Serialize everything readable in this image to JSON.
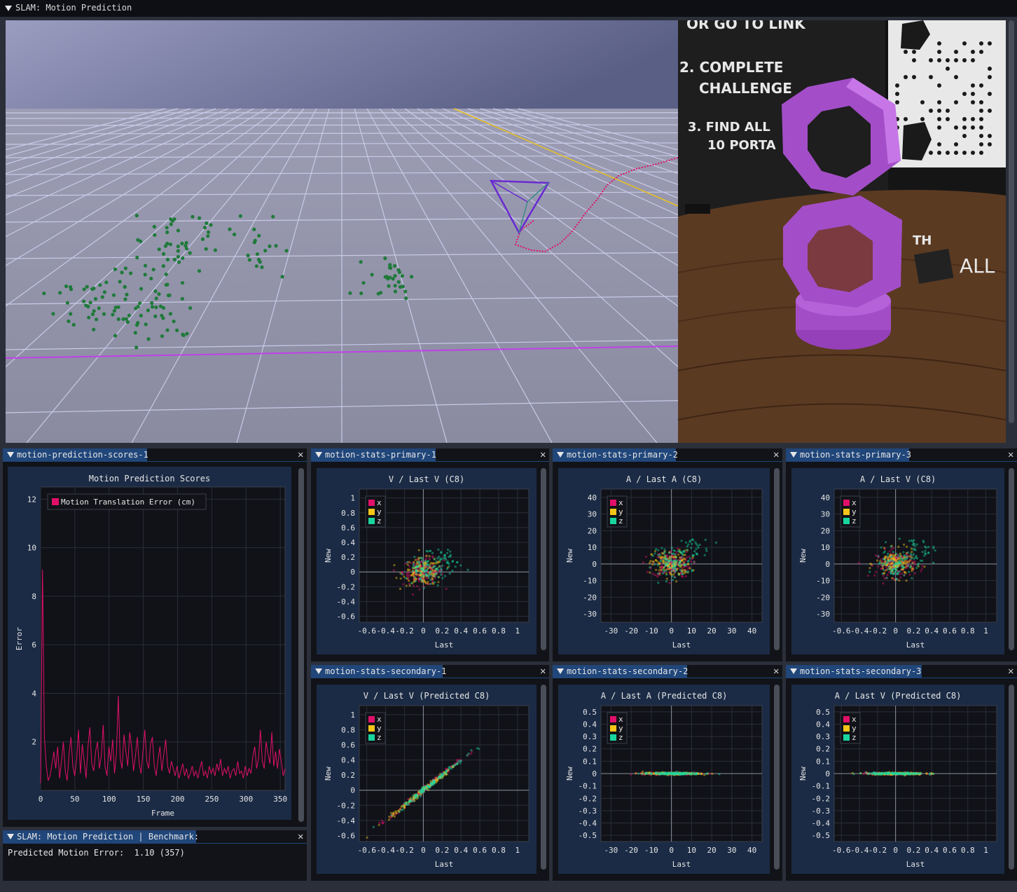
{
  "window": {
    "title": "SLAM: Motion Prediction"
  },
  "colors": {
    "x": "#e0106a",
    "y": "#f5c518",
    "z": "#19d6a0",
    "tab": "#20467a",
    "plot_bg": "#1b2b45"
  },
  "scores_panel": {
    "tab": "motion-prediction-scores-1",
    "chart_data": {
      "type": "line",
      "title": "Motion Prediction Scores",
      "xlabel": "Frame",
      "ylabel": "Error",
      "xlim": [
        0,
        357
      ],
      "ylim": [
        0,
        12.5
      ],
      "xticks": [
        "0",
        "50",
        "100",
        "150",
        "200",
        "250",
        "300",
        "350"
      ],
      "yticks": [
        "2",
        "4",
        "6",
        "8",
        "10",
        "12"
      ],
      "legend_position": "top-left",
      "series": [
        {
          "name": "Motion Translation Error (cm)",
          "color": "#e0106a",
          "values": [
            0.3,
            9.1,
            2.2,
            1.0,
            0.4,
            0.6,
            1.1,
            1.6,
            0.9,
            1.8,
            0.5,
            1.2,
            2.0,
            0.8,
            0.4,
            1.5,
            2.2,
            1.0,
            0.6,
            1.3,
            2.5,
            0.7,
            1.9,
            1.2,
            0.5,
            1.8,
            2.6,
            1.1,
            0.8,
            1.6,
            2.0,
            0.9,
            1.4,
            2.7,
            1.0,
            0.6,
            1.8,
            1.2,
            2.1,
            0.7,
            1.5,
            3.9,
            1.3,
            0.9,
            2.3,
            1.6,
            1.0,
            2.4,
            1.8,
            0.8,
            1.4,
            2.2,
            1.1,
            0.7,
            1.6,
            2.5,
            1.2,
            0.9,
            1.9,
            2.2,
            1.0,
            0.6,
            1.3,
            1.8,
            0.8,
            1.5,
            2.1,
            1.0,
            0.7,
            1.2,
            0.9,
            0.6,
            1.0,
            0.5,
            0.8,
            1.1,
            0.6,
            0.9,
            0.5,
            0.7,
            1.0,
            0.6,
            0.8,
            0.5,
            0.9,
            1.2,
            0.6,
            0.8,
            0.5,
            1.0,
            0.7,
            0.9,
            0.6,
            1.1,
            0.8,
            1.3,
            0.6,
            0.9,
            0.7,
            1.0,
            0.5,
            0.8,
            0.9,
            0.6,
            1.2,
            0.7,
            0.8,
            0.5,
            1.0,
            0.6,
            0.9,
            0.7,
            1.4,
            1.8,
            0.9,
            1.3,
            2.5,
            1.2,
            0.9,
            2.0,
            1.5,
            1.1,
            2.4,
            1.0,
            1.6,
            0.9,
            1.7,
            1.2,
            0.6,
            0.9
          ]
        }
      ]
    }
  },
  "benchmark_panel": {
    "tab": "SLAM: Motion Prediction | Benchmark:",
    "label": "Predicted Motion Error:",
    "value": "1.10 (357)"
  },
  "stat_panels": [
    {
      "tab": "motion-stats-primary-1",
      "chart_data": {
        "type": "scatter",
        "title": "V / Last V (C8)",
        "xlabel": "Last",
        "ylabel": "New",
        "xlim": [
          -0.68,
          1.12
        ],
        "ylim": [
          -0.68,
          1.12
        ],
        "xticks": [
          "-0.6",
          "-0.4",
          "-0.2",
          "0",
          "0.2",
          "0.4",
          "0.6",
          "0.8",
          "1"
        ],
        "yticks": [
          "-0.6",
          "-0.4",
          "-0.2",
          "0",
          "0.2",
          "0.4",
          "0.6",
          "0.8",
          "1"
        ],
        "legend": [
          "x",
          "y",
          "z"
        ],
        "legend_position": "top-left",
        "mode": "cloud"
      }
    },
    {
      "tab": "motion-stats-primary-2",
      "chart_data": {
        "type": "scatter",
        "title": "A / Last A (C8)",
        "xlabel": "Last",
        "ylabel": "New",
        "xlim": [
          -35,
          45
        ],
        "ylim": [
          -35,
          45
        ],
        "xticks": [
          "-30",
          "-20",
          "-10",
          "0",
          "10",
          "20",
          "30",
          "40"
        ],
        "yticks": [
          "-30",
          "-20",
          "-10",
          "0",
          "10",
          "20",
          "30",
          "40"
        ],
        "legend": [
          "x",
          "y",
          "z"
        ],
        "legend_position": "top-left",
        "mode": "cloud"
      }
    },
    {
      "tab": "motion-stats-primary-3",
      "chart_data": {
        "type": "scatter",
        "title": "A / Last V (C8)",
        "xlabel": "Last",
        "ylabel": "New",
        "xlim": [
          -0.68,
          1.12
        ],
        "ylim": [
          -35,
          45
        ],
        "xticks": [
          "-0.6",
          "-0.4",
          "-0.2",
          "0",
          "0.2",
          "0.4",
          "0.6",
          "0.8",
          "1"
        ],
        "yticks": [
          "-30",
          "-20",
          "-10",
          "0",
          "10",
          "20",
          "30",
          "40"
        ],
        "legend": [
          "x",
          "y",
          "z"
        ],
        "legend_position": "top-left",
        "mode": "cloud"
      }
    },
    {
      "tab": "motion-stats-secondary-1",
      "chart_data": {
        "type": "scatter",
        "title": "V / Last V (Predicted C8)",
        "xlabel": "Last",
        "ylabel": "New",
        "xlim": [
          -0.68,
          1.12
        ],
        "ylim": [
          -0.68,
          1.12
        ],
        "xticks": [
          "-0.6",
          "-0.4",
          "-0.2",
          "0",
          "0.2",
          "0.4",
          "0.6",
          "0.8",
          "1"
        ],
        "yticks": [
          "-0.6",
          "-0.4",
          "-0.2",
          "0",
          "0.2",
          "0.4",
          "0.6",
          "0.8",
          "1"
        ],
        "legend": [
          "x",
          "y",
          "z"
        ],
        "legend_position": "top-left",
        "mode": "diagonal"
      }
    },
    {
      "tab": "motion-stats-secondary-2",
      "chart_data": {
        "type": "scatter",
        "title": "A / Last A (Predicted C8)",
        "xlabel": "Last",
        "ylabel": "New",
        "xlim": [
          -35,
          45
        ],
        "ylim": [
          -0.55,
          0.55
        ],
        "xticks": [
          "-30",
          "-20",
          "-10",
          "0",
          "10",
          "20",
          "30",
          "40"
        ],
        "yticks": [
          "-0.5",
          "-0.4",
          "-0.3",
          "-0.2",
          "-0.1",
          "0",
          "0.1",
          "0.2",
          "0.3",
          "0.4",
          "0.5"
        ],
        "legend": [
          "x",
          "y",
          "z"
        ],
        "legend_position": "top-left",
        "mode": "flat"
      }
    },
    {
      "tab": "motion-stats-secondary-3",
      "chart_data": {
        "type": "scatter",
        "title": "A / Last V (Predicted C8)",
        "xlabel": "Last",
        "ylabel": "New",
        "xlim": [
          -0.68,
          1.12
        ],
        "ylim": [
          -0.55,
          0.55
        ],
        "xticks": [
          "-0.6",
          "-0.4",
          "-0.2",
          "0",
          "0.2",
          "0.4",
          "0.6",
          "0.8",
          "1"
        ],
        "yticks": [
          "-0.5",
          "-0.4",
          "-0.3",
          "-0.2",
          "-0.1",
          "0",
          "0.1",
          "0.2",
          "0.3",
          "0.4",
          "0.5"
        ],
        "legend": [
          "x",
          "y",
          "z"
        ],
        "legend_position": "top-left",
        "mode": "flat"
      }
    }
  ],
  "camera_text": {
    "line1": "OR GO TO LINK",
    "line2": "2. COMPLETE",
    "line3": "CHALLENGE",
    "line4": "3. FIND ALL",
    "line5": "10 PORTA",
    "line6": "TH",
    "line7": "ALL"
  }
}
